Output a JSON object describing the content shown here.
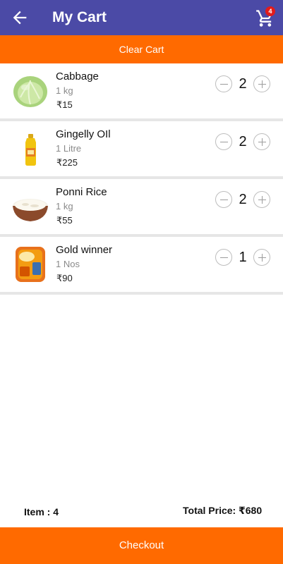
{
  "header": {
    "title": "My Cart",
    "cart_badge": "4",
    "back_icon": "arrow-left-icon",
    "cart_icon": "shopping-cart-icon",
    "color": "#4b4aa6"
  },
  "clear_cart": {
    "label": "Clear Cart",
    "color": "#ff6a00"
  },
  "items": [
    {
      "name": "Cabbage",
      "unit": "1 kg",
      "price": "₹15",
      "qty": "2",
      "image_icon": "cabbage-image"
    },
    {
      "name": "Gingelly OIl",
      "unit": "1 Litre",
      "price": "₹225",
      "qty": "2",
      "image_icon": "oil-bottle-image"
    },
    {
      "name": "Ponni Rice",
      "unit": "1 kg",
      "price": "₹55",
      "qty": "2",
      "image_icon": "rice-bowl-image"
    },
    {
      "name": "Gold winner",
      "unit": "1 Nos",
      "price": "₹90",
      "qty": "1",
      "image_icon": "gold-winner-pack-image"
    }
  ],
  "summary": {
    "item_count": "Item : 4",
    "total_label": "Total Price:",
    "total_value": "₹680"
  },
  "checkout": {
    "label": "Checkout",
    "color": "#ff6a00"
  }
}
